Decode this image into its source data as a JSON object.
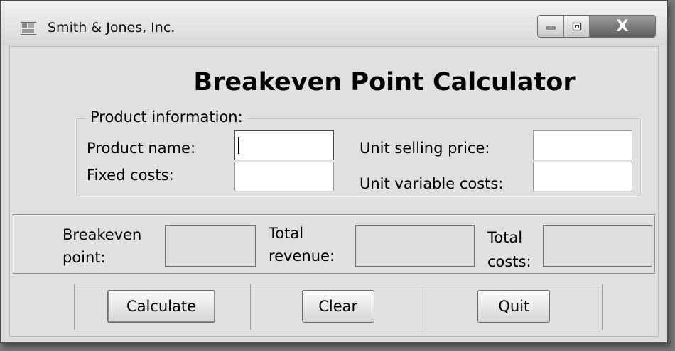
{
  "window": {
    "title": "Smith & Jones, Inc.",
    "controls": [
      "minimize-icon",
      "maximize-icon",
      "close-icon"
    ],
    "close_glyph": "X"
  },
  "form": {
    "heading": "Breakeven Point Calculator",
    "product_group": {
      "legend": "Product information:",
      "product_name_label": "Product name:",
      "product_name_value": "",
      "fixed_costs_label": "Fixed costs:",
      "fixed_costs_value": "",
      "unit_price_label": "Unit selling price:",
      "unit_price_value": "",
      "unit_variable_label": "Unit variable costs:",
      "unit_variable_value": ""
    },
    "results": {
      "breakeven_label_1": "Breakeven",
      "breakeven_label_2": "point:",
      "breakeven_value": "",
      "revenue_label_1": "Total",
      "revenue_label_2": "revenue:",
      "revenue_value": "",
      "costs_label_1": "Total",
      "costs_label_2": "costs:",
      "costs_value": ""
    },
    "buttons": {
      "calculate": "Calculate",
      "clear": "Clear",
      "quit": "Quit"
    }
  }
}
